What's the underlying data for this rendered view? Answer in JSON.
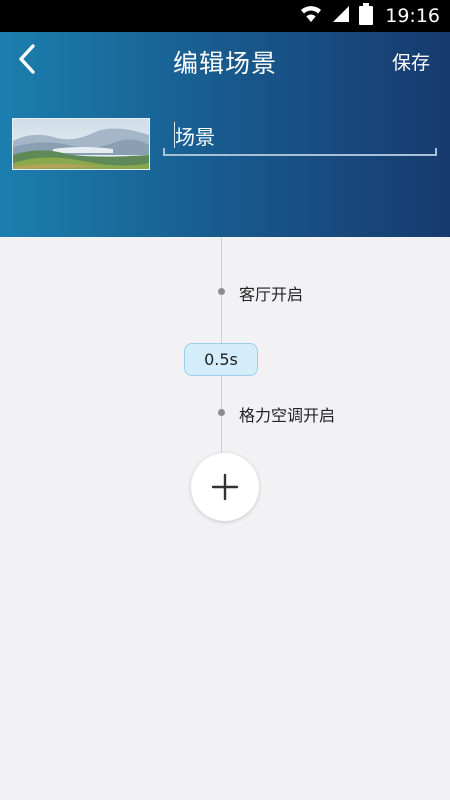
{
  "status_bar": {
    "time": "19:16"
  },
  "header": {
    "title": "编辑场景",
    "save_label": "保存"
  },
  "scene": {
    "name": "场景"
  },
  "timeline": {
    "steps": [
      {
        "label": "客厅开启"
      },
      {
        "label": "格力空调开启"
      }
    ],
    "delay": "0.5s"
  },
  "colors": {
    "header_start": "#1b7fae",
    "header_end": "#173a6e",
    "delay_badge": "#d4edfa",
    "background": "#f2f2f4"
  },
  "icons": [
    "wifi-icon",
    "signal-icon",
    "battery-icon",
    "back-arrow-icon",
    "plus-icon"
  ]
}
